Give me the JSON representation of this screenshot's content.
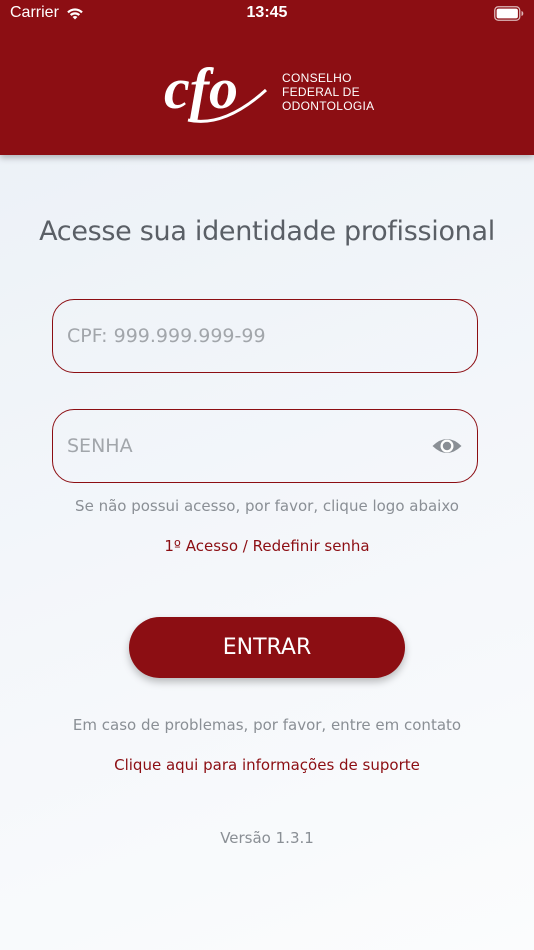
{
  "status_bar": {
    "carrier": "Carrier",
    "time": "13:45",
    "wifi_icon": "wifi-icon",
    "battery_icon": "battery-icon"
  },
  "header": {
    "logo_mark": "cfo",
    "logo_lines": [
      "CONSELHO",
      "FEDERAL DE",
      "ODONTOLOGIA"
    ],
    "background_color": "#8c0e13"
  },
  "login": {
    "title": "Acesse sua identidade profissional",
    "cpf_placeholder": "CPF: 999.999.999-99",
    "cpf_value": "",
    "password_placeholder": "SENHA",
    "password_value": "",
    "password_toggle_icon": "eye-icon",
    "access_hint": "Se não possui acesso, por favor, clique logo abaixo",
    "first_access_link": "1º Acesso / Redefinir senha",
    "enter_button": "ENTRAR",
    "problems_hint": "Em caso de problemas, por favor, entre em contato",
    "support_link": "Clique aqui para informações de suporte",
    "version": "Versão 1.3.1"
  },
  "colors": {
    "accent": "#8c0e13",
    "muted_text": "#8a8f95",
    "title_text": "#5a5f66"
  }
}
